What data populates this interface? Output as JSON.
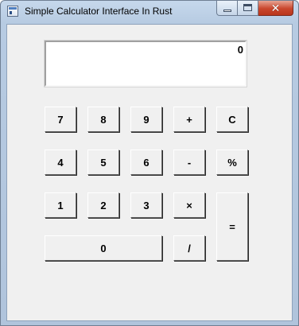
{
  "window": {
    "title": "Simple Calculator Interface In Rust",
    "caption_buttons": {
      "minimize": "minimize-icon",
      "maximize": "maximize-icon",
      "close": "close-icon"
    },
    "close_glyph": "✕"
  },
  "display": {
    "value": "0"
  },
  "keys": {
    "k7": "7",
    "k8": "8",
    "k9": "9",
    "plus": "+",
    "clear": "C",
    "k4": "4",
    "k5": "5",
    "k6": "6",
    "minus": "-",
    "percent": "%",
    "k1": "1",
    "k2": "2",
    "k3": "3",
    "multiply": "×",
    "equals": "=",
    "k0": "0",
    "divide": "/"
  },
  "colors": {
    "close_button": "#c9462c",
    "client_bg": "#f0f0f0",
    "frame": "#b7cbe2"
  }
}
